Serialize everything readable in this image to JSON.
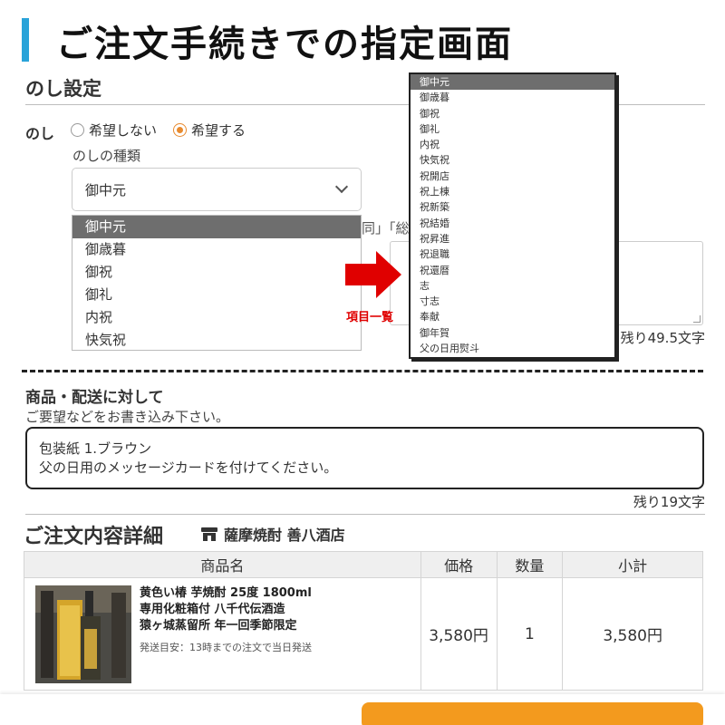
{
  "header": {
    "title": "ご注文手続きでの指定画面"
  },
  "noshi": {
    "section_title": "のし設定",
    "label": "のし",
    "radio_options": [
      {
        "label": "希望しない",
        "checked": false
      },
      {
        "label": "希望する",
        "checked": true
      }
    ],
    "type_label": "のしの種類",
    "select_value": "御中元",
    "dropdown_options": [
      "御中元",
      "御歳暮",
      "御祝",
      "御礼",
      "内祝",
      "快気祝"
    ],
    "partial_text": "同」「総",
    "remaining_text": "残り49.5文字"
  },
  "annotation": {
    "arrow_label": "項目一覧",
    "arrow_color": "#e00000"
  },
  "popup_list": {
    "options": [
      "御中元",
      "御歳暮",
      "御祝",
      "御礼",
      "内祝",
      "快気祝",
      "祝開店",
      "祝上棟",
      "祝新築",
      "祝結婚",
      "祝昇進",
      "祝退職",
      "祝還暦",
      "志",
      "寸志",
      "奉献",
      "御年賀",
      "父の日用熨斗"
    ],
    "selected": "御中元"
  },
  "comment": {
    "title": "商品・配送に対して",
    "subtitle": "ご要望などをお書き込み下さい。",
    "lines": [
      "包装紙 1.ブラウン",
      "父の日用のメッセージカードを付けてください。"
    ],
    "remaining_text": "残り19文字"
  },
  "order": {
    "title": "ご注文内容詳細",
    "shop_icon": "store-icon",
    "shop_name": "薩摩焼酎 善八酒店",
    "columns": [
      "商品名",
      "価格",
      "数量",
      "小計"
    ],
    "items": [
      {
        "name_lines": [
          "黄色い椿 芋焼酎 25度 1800ml",
          "専用化粧箱付 八千代伝酒造",
          "猿ヶ城蒸留所 年一回季節限定"
        ],
        "shipping_note": "発送目安：13時までの注文で当日発送",
        "price": "3,580円",
        "quantity": "1",
        "subtotal": "3,580円"
      }
    ]
  },
  "colors": {
    "accent_blue": "#29a3d9",
    "radio_orange": "#e88a2e",
    "button_orange": "#f39a1e"
  }
}
